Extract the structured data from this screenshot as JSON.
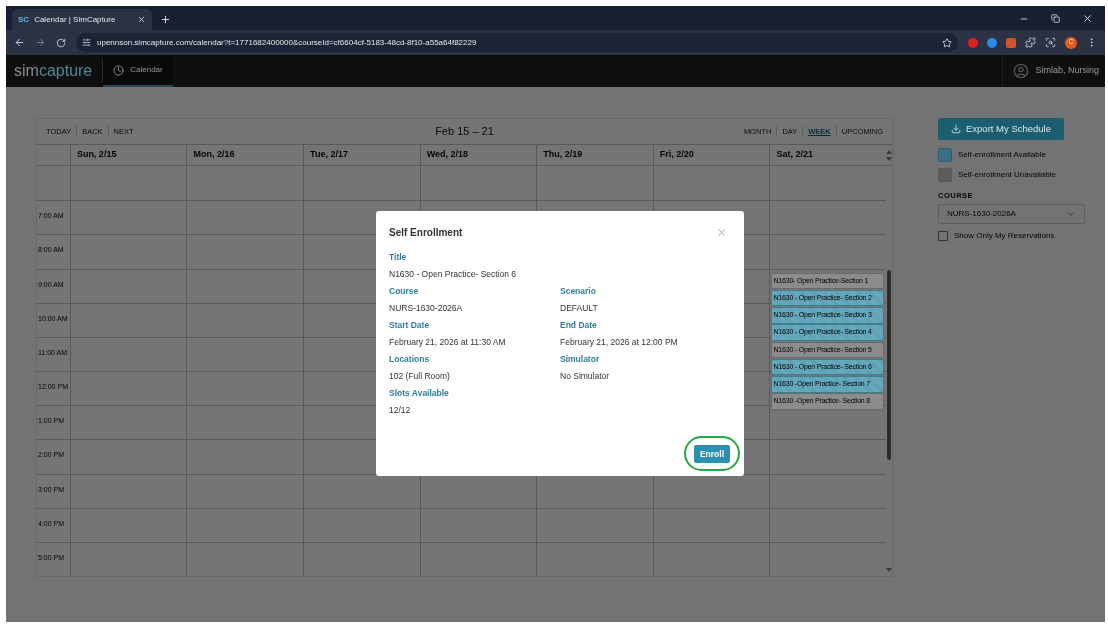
{
  "browser": {
    "tab": {
      "favicon": "SC",
      "title": "Calendar | SimCapture"
    },
    "url": "upennson.simcapture.com/calendar?t=1771682400000&courseId=cf6604cf-5183-48cd-8f10-a55a64f82229",
    "profile_initial": "C"
  },
  "app_header": {
    "logo": {
      "lead": "sim",
      "rest": "capture"
    },
    "nav": [
      {
        "label": "Calendar",
        "selected": true
      }
    ],
    "user": "Simlab, Nursing"
  },
  "calendar": {
    "nav_buttons": [
      "TODAY",
      "BACK",
      "NEXT"
    ],
    "range": "Feb 15 – 21",
    "views": [
      {
        "label": "MONTH",
        "selected": false
      },
      {
        "label": "DAY",
        "selected": false
      },
      {
        "label": "WEEK",
        "selected": true
      },
      {
        "label": "UPCOMING",
        "selected": false
      }
    ],
    "days": [
      {
        "label": "Sun, 2/15"
      },
      {
        "label": "Mon, 2/16"
      },
      {
        "label": "Tue, 2/17"
      },
      {
        "label": "Wed, 2/18"
      },
      {
        "label": "Thu, 2/19"
      },
      {
        "label": "Fri, 2/20"
      },
      {
        "label": "Sat, 2/21",
        "events": [
          {
            "title": "N1630- Open Practice-Section 1",
            "available": false
          },
          {
            "title": "N1630 - Open Practice- Section 2",
            "available": true
          },
          {
            "title": "N1630 - Open Practice- Section 3",
            "available": true
          },
          {
            "title": "N1630 - Open Practice- Section 4",
            "available": true
          },
          {
            "title": "N1630 - Open Practice- Section 5",
            "available": false
          },
          {
            "title": "N1630 - Open Practice- Section 6",
            "available": true
          },
          {
            "title": "N1630 -Open Practice- Section 7",
            "available": true
          },
          {
            "title": "N1630 -Open Practice- Section 8",
            "available": false
          }
        ]
      }
    ],
    "hours": [
      "7:00 AM",
      "8:00 AM",
      "9:00 AM",
      "10:00 AM",
      "11:00 AM",
      "12:00 PM",
      "1:00 PM",
      "2:00 PM",
      "3:00 PM",
      "4:00 PM",
      "5:00 PM"
    ]
  },
  "sidebar": {
    "export_button": "Export My Schedule",
    "legend": [
      {
        "label": "Self-enrollment Available",
        "kind": "available"
      },
      {
        "label": "Self-enrollment Unavailable",
        "kind": "unavailable"
      }
    ],
    "course_label": "COURSE",
    "course_value": "NURS-1630-2026A",
    "show_only_mine": {
      "label": "Show Only My Reservations",
      "checked": false
    }
  },
  "modal": {
    "title": "Self Enrollment",
    "rows": [
      [
        {
          "label": "Title",
          "value": "N1630 - Open Practice- Section 6"
        }
      ],
      [
        {
          "label": "Course",
          "value": "NURS-1630-2026A"
        },
        {
          "label": "Scenario",
          "value": "DEFAULT"
        }
      ],
      [
        {
          "label": "Start Date",
          "value": "February 21, 2026 at 11:30 AM"
        },
        {
          "label": "End Date",
          "value": "February 21, 2026 at 12:00 PM"
        }
      ],
      [
        {
          "label": "Locations",
          "value": "102 (Full Room)"
        },
        {
          "label": "Simulator",
          "value": "No Simulator"
        }
      ],
      [
        {
          "label": "Slots Available",
          "value": "12/12"
        }
      ]
    ],
    "button": "Enroll",
    "button_highlighted": true
  }
}
